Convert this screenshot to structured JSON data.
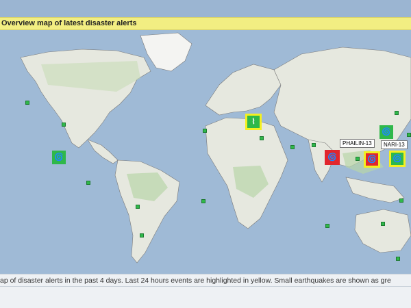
{
  "header": {
    "title": "Overview map of latest disaster alerts"
  },
  "caption": {
    "text": "ap of disaster alerts in the past 4 days. Last 24 hours events are highlighted in yellow. Small earthquakes are shown as gre"
  },
  "colors": {
    "green_alert": "#2fb84a",
    "red_alert": "#e1262d",
    "highlight": "#f4f021",
    "water": "#9fbad6",
    "land": "#eaeae4"
  },
  "alerts": [
    {
      "type": "tropical-cyclone",
      "level": "green",
      "highlight": false,
      "label": ""
    },
    {
      "type": "earthquake",
      "level": "green",
      "highlight": true,
      "label": ""
    },
    {
      "type": "tropical-cyclone",
      "level": "red",
      "highlight": false,
      "label": "PHAILIN-13"
    },
    {
      "type": "tropical-cyclone",
      "level": "red",
      "highlight": true,
      "label": "NARI-13"
    },
    {
      "type": "tropical-cyclone",
      "level": "green",
      "highlight": true,
      "label": ""
    },
    {
      "type": "tropical-cyclone",
      "level": "green",
      "highlight": false,
      "label": ""
    }
  ]
}
